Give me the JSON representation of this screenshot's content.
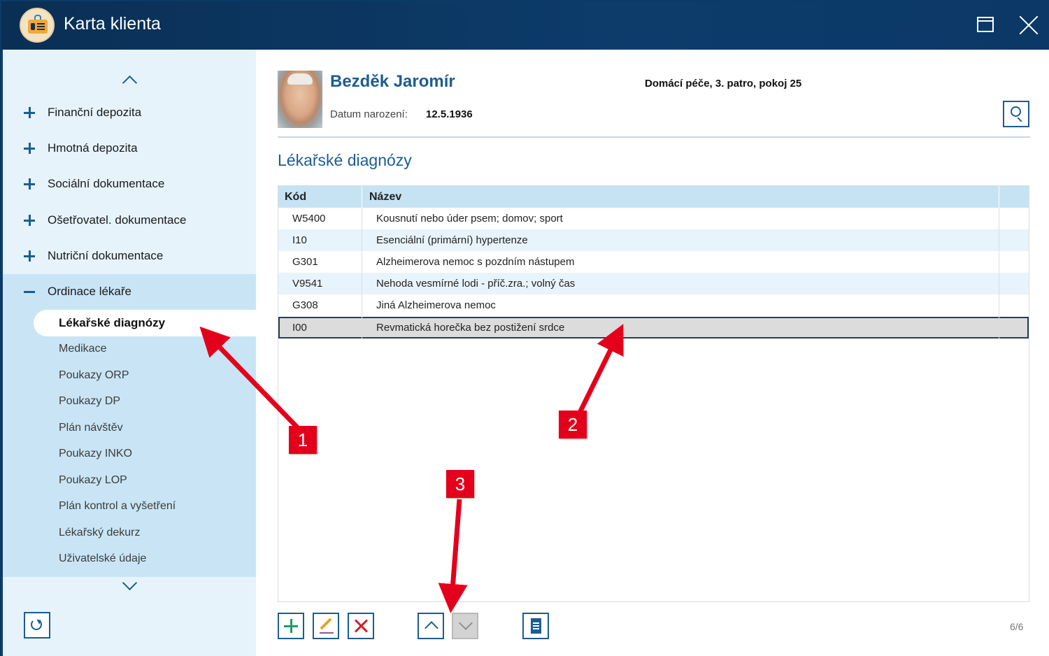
{
  "window": {
    "title": "Karta klienta",
    "app_icon": "client-card-icon",
    "maximize_icon": "maximize-icon",
    "close_icon": "close-icon"
  },
  "sidebar": {
    "scroll_up_icon": "chevron-up-icon",
    "scroll_down_icon": "chevron-down-icon",
    "categories": [
      {
        "label": "Finanční depozita",
        "state": "collapsed"
      },
      {
        "label": "Hmotná depozita",
        "state": "collapsed"
      },
      {
        "label": "Sociální dokumentace",
        "state": "collapsed"
      },
      {
        "label": "Ošetřovatel. dokumentace",
        "state": "collapsed"
      },
      {
        "label": "Nutriční dokumentace",
        "state": "collapsed"
      },
      {
        "label": "Ordinace lékaře",
        "state": "expanded"
      }
    ],
    "sub_items": [
      "Lékařské diagnózy",
      "Medikace",
      "Poukazy ORP",
      "Poukazy DP",
      "Plán návštěv",
      "Poukazy INKO",
      "Poukazy LOP",
      "Plán kontrol a vyšetření",
      "Lékařský dekurz",
      "Uživatelské údaje"
    ],
    "active_sub_item": "Lékařské diagnózy",
    "refresh_icon": "refresh-icon"
  },
  "patient": {
    "name": "Bezděk Jaromír",
    "dob_label": "Datum narození:",
    "dob": "12.5.1936",
    "location": "Domácí péče, 3. patro, pokoj 25"
  },
  "section": {
    "title": "Lékařské diagnózy"
  },
  "table": {
    "columns": [
      "Kód",
      "Název"
    ],
    "rows": [
      {
        "code": "W5400",
        "name": "Kousnutí nebo úder psem; domov; sport"
      },
      {
        "code": "I10",
        "name": "Esenciální (primární) hypertenze"
      },
      {
        "code": "G301",
        "name": "Alzheimerova nemoc s pozdním nástupem"
      },
      {
        "code": "V9541",
        "name": "Nehoda vesmírné lodi - příč.zra.; volný čas"
      },
      {
        "code": "G308",
        "name": "Jiná Alzheimerova nemoc"
      },
      {
        "code": "I00",
        "name": "Revmatická horečka bez postižení srdce"
      }
    ],
    "selected_row": 5
  },
  "toolbar": {
    "icons": [
      "add-icon",
      "edit-icon",
      "delete-icon",
      "move-up-icon",
      "move-down-icon",
      "document-icon"
    ],
    "pager": "6/6"
  },
  "annotations": {
    "badges": [
      "1",
      "2",
      "3"
    ],
    "color": "#e4001b"
  },
  "colors": {
    "titlebar": "#0b3a66",
    "accent": "#1b5d91",
    "sidebar_bg": "#e6f3fb",
    "sidebar_expanded_bg": "#c9e5f5",
    "table_header": "#c6e3f4",
    "table_alt_row": "#e8f4fb",
    "selected_row": "#dcdcdc"
  }
}
